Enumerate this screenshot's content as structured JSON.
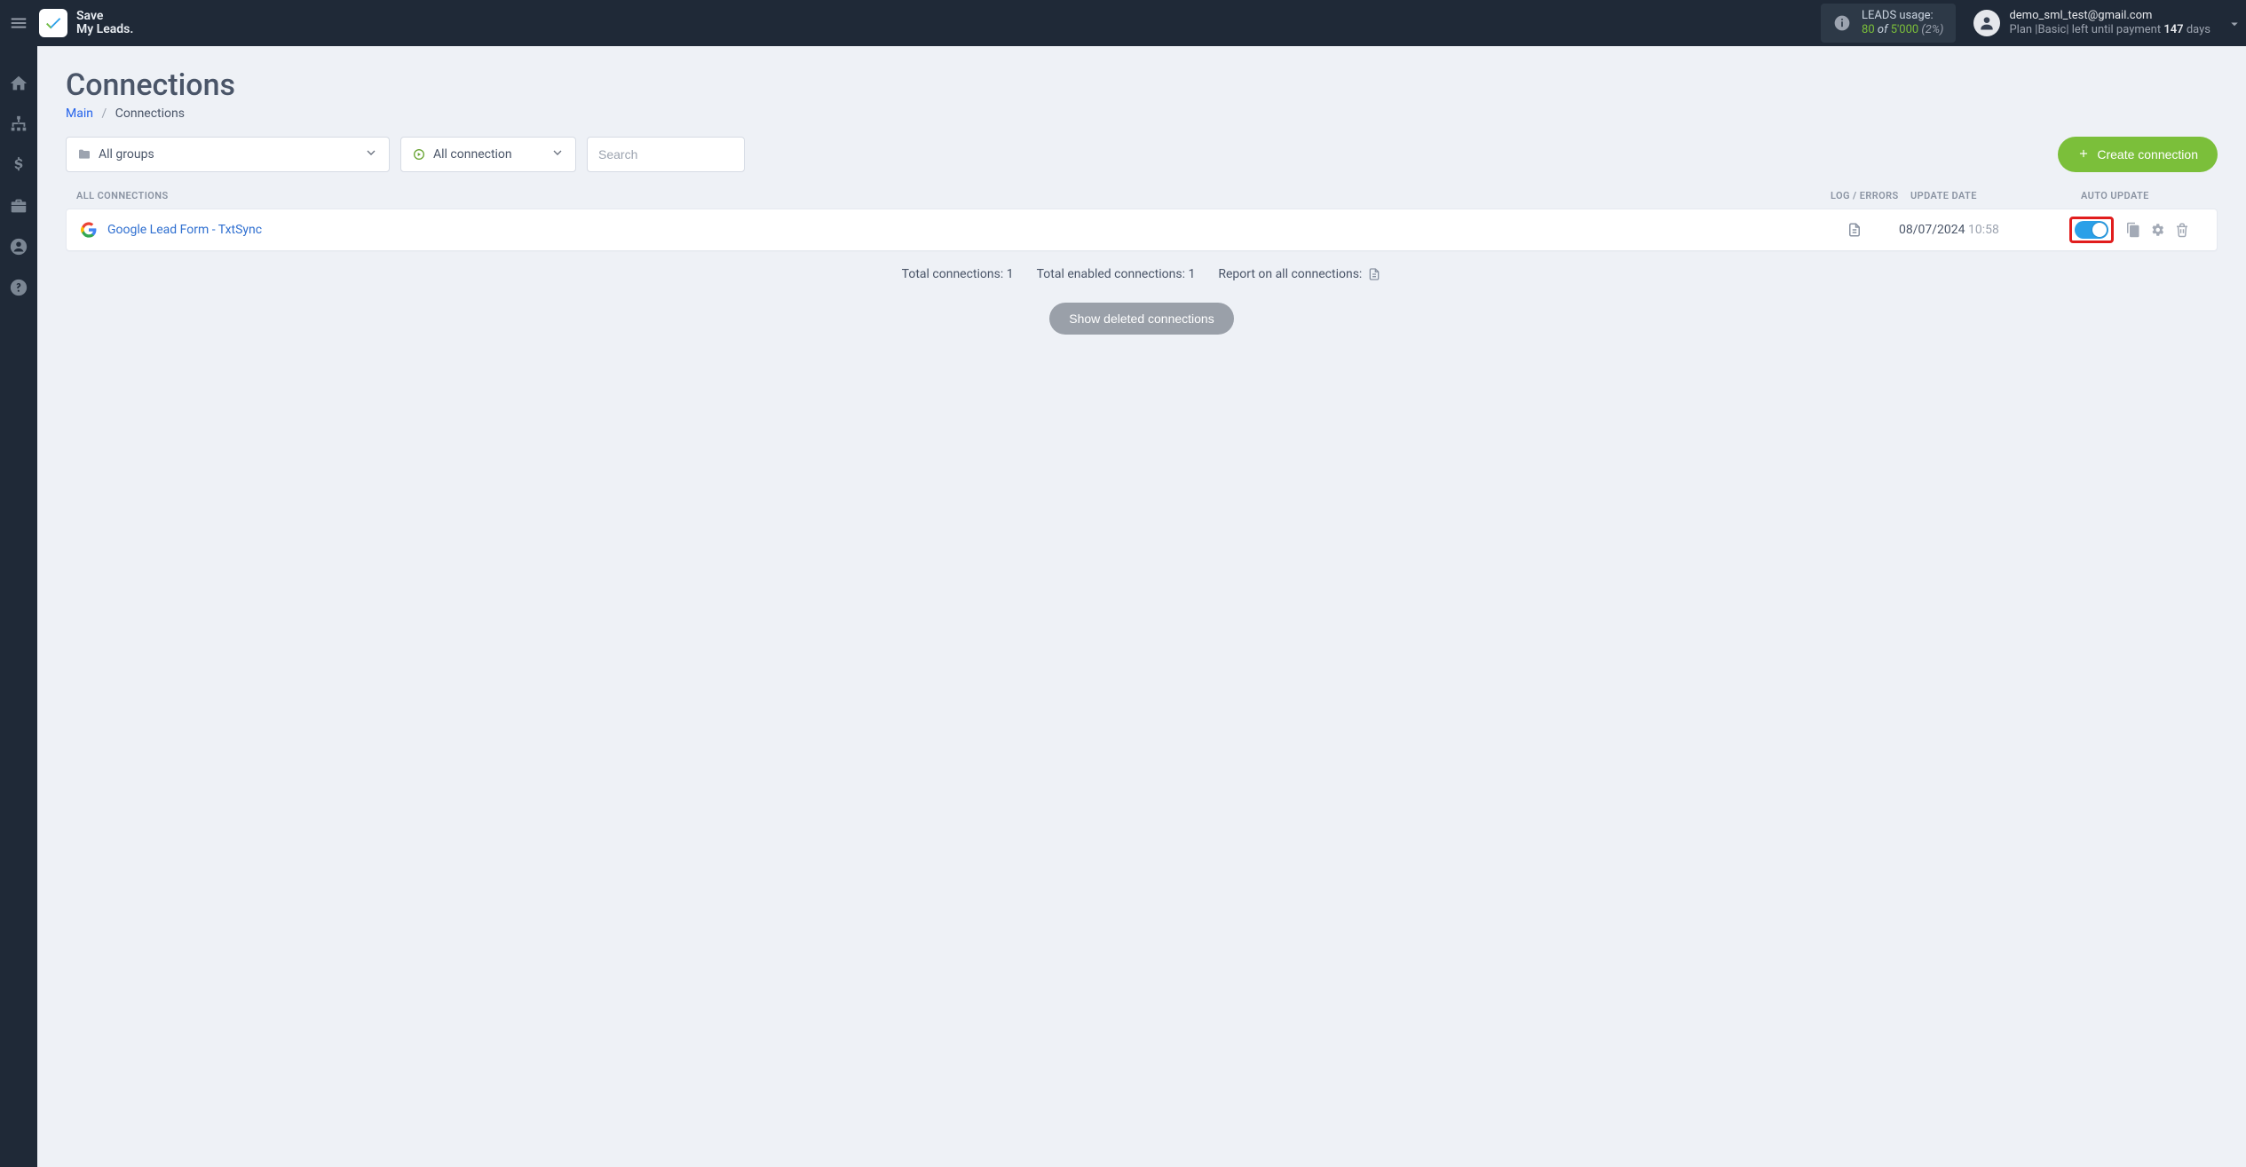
{
  "brand": {
    "line1": "Save",
    "line2": "My Leads."
  },
  "usage": {
    "label": "LEADS usage:",
    "used": "80",
    "of": "of",
    "total": "5'000",
    "pct": "(2%)"
  },
  "account": {
    "email": "demo_sml_test@gmail.com",
    "plan_prefix": "Plan |",
    "plan_name": "Basic",
    "plan_mid": "| left until payment ",
    "days": "147",
    "days_suffix": " days"
  },
  "page": {
    "title": "Connections",
    "breadcrumb_main": "Main",
    "breadcrumb_current": "Connections"
  },
  "filters": {
    "groups_label": "All groups",
    "status_label": "All connection",
    "search_placeholder": "Search"
  },
  "create_label": "Create connection",
  "columns": {
    "name": "All connections",
    "log": "Log / Errors",
    "date": "Update date",
    "auto": "Auto update"
  },
  "rows": [
    {
      "name": "Google Lead Form - TxtSync",
      "date": "08/07/2024",
      "time": "10:58",
      "auto_on": true
    }
  ],
  "summary": {
    "total": "Total connections: 1",
    "enabled": "Total enabled connections: 1",
    "report": "Report on all connections:"
  },
  "show_deleted": "Show deleted connections"
}
